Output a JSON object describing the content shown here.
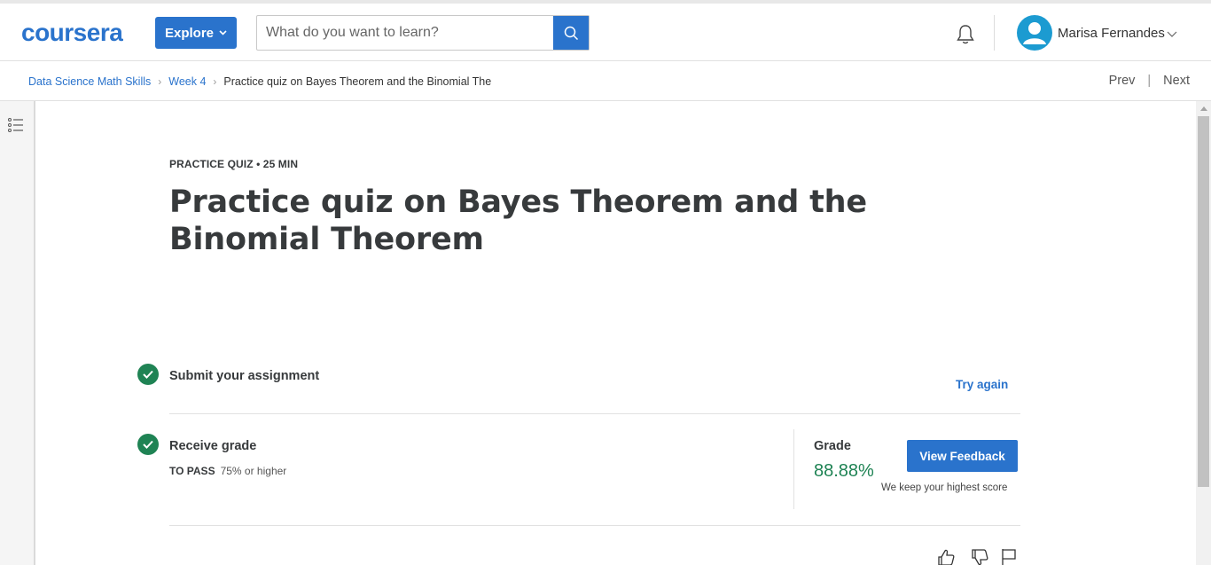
{
  "header": {
    "logo": "coursera",
    "explore_label": "Explore",
    "search_placeholder": "What do you want to learn?",
    "user_name": "Marisa Fernandes"
  },
  "breadcrumb": {
    "items": [
      "Data Science Math Skills",
      "Week 4"
    ],
    "current": "Practice quiz on Bayes Theorem and the Binomial The"
  },
  "nav": {
    "prev": "Prev",
    "next": "Next",
    "separator": "|"
  },
  "quiz": {
    "meta": "PRACTICE QUIZ • 25 MIN",
    "title": "Practice quiz on Bayes Theorem and the Binomial Theorem"
  },
  "submit_step": {
    "title": "Submit your assignment",
    "action": "Try again"
  },
  "grade_step": {
    "title": "Receive grade",
    "to_pass_label": "TO PASS",
    "to_pass_value": "75% or higher",
    "grade_label": "Grade",
    "grade_value": "88.88%",
    "feedback_button": "View Feedback",
    "note": "We keep your highest score"
  },
  "colors": {
    "brand": "#2a73cc",
    "success": "#1f8354"
  },
  "icons": [
    "search-icon",
    "bell-icon",
    "user-avatar-icon",
    "chevron-down-icon",
    "list-icon",
    "check-icon",
    "thumbs-up-icon",
    "thumbs-down-icon",
    "flag-icon"
  ]
}
